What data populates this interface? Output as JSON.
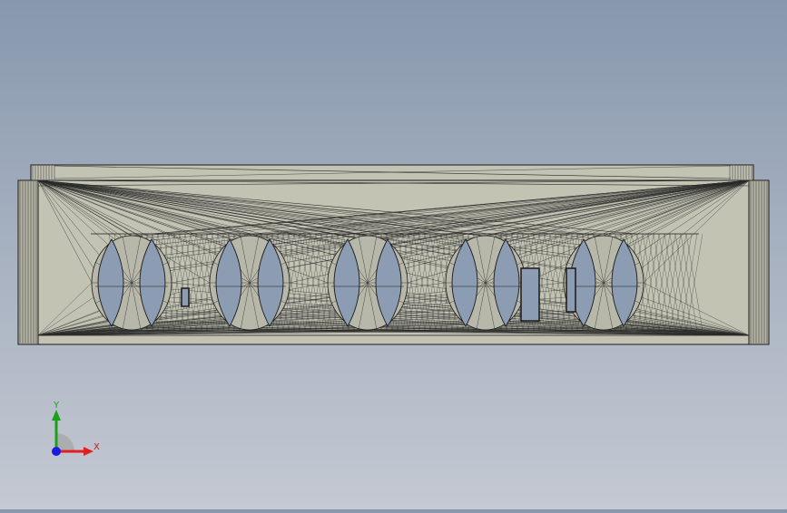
{
  "viewport": {
    "colors": {
      "part_face": "#c3c3b4",
      "part_face_shade": "#b5b5a6",
      "part_edge": "#1a1a1a",
      "mesh_line": "#2b2b2b",
      "hole_color": "#8c9cb3"
    }
  },
  "triad": {
    "x_label": "X",
    "y_label": "Y",
    "colors": {
      "x": "#e02020",
      "y": "#1aa01a",
      "z": "#1a1ae0",
      "x_label": "#c02020",
      "y_label": "#20a020"
    }
  }
}
